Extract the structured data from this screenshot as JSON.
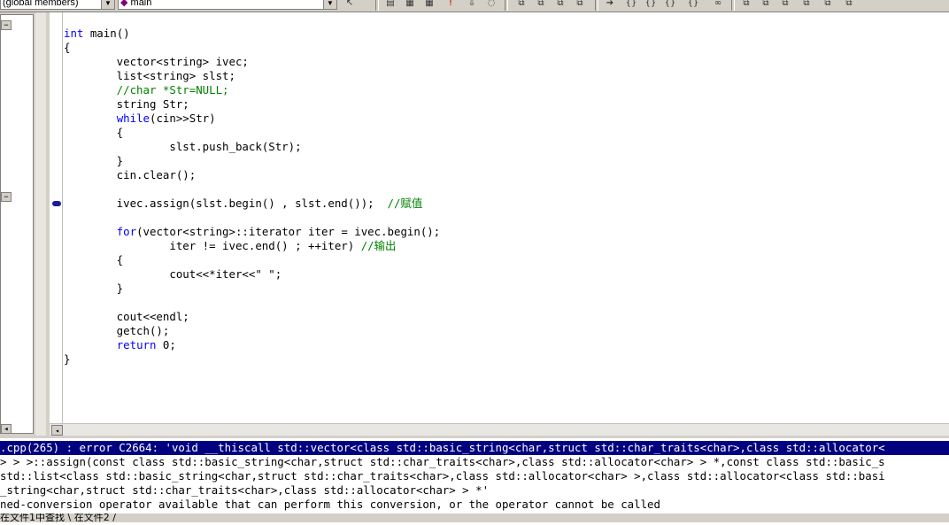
{
  "toolbar": {
    "class_combo": "(global members)",
    "func_combo": "main"
  },
  "editor": {
    "lines": [
      [
        {
          "t": "int",
          "c": "kw"
        },
        {
          "t": " main()"
        }
      ],
      [
        {
          "t": "{"
        }
      ],
      [
        {
          "t": "        vector<string> ivec;"
        }
      ],
      [
        {
          "t": "        list<string> slst;"
        }
      ],
      [
        {
          "t": "        //char *Str=NULL;",
          "c": "cm"
        }
      ],
      [
        {
          "t": "        string Str;"
        }
      ],
      [
        {
          "t": "        "
        },
        {
          "t": "while",
          "c": "kw"
        },
        {
          "t": "(cin>>Str)"
        }
      ],
      [
        {
          "t": "        {"
        }
      ],
      [
        {
          "t": "                slst.push_back(Str);"
        }
      ],
      [
        {
          "t": "        }"
        }
      ],
      [
        {
          "t": "        cin.clear();"
        }
      ],
      [
        {
          "t": ""
        }
      ],
      [
        {
          "t": "        ivec.assign(slst.begin() , slst.end());  "
        },
        {
          "t": "//赋值",
          "c": "cm"
        }
      ],
      [
        {
          "t": ""
        }
      ],
      [
        {
          "t": "        "
        },
        {
          "t": "for",
          "c": "kw"
        },
        {
          "t": "(vector<string>::iterator iter = ivec.begin();"
        }
      ],
      [
        {
          "t": "                iter != ivec.end() ; ++iter) "
        },
        {
          "t": "//输出",
          "c": "cm"
        }
      ],
      [
        {
          "t": "        {"
        }
      ],
      [
        {
          "t": "                cout<<*iter<<\" \";"
        }
      ],
      [
        {
          "t": "        }"
        }
      ],
      [
        {
          "t": ""
        }
      ],
      [
        {
          "t": "        cout<<endl;"
        }
      ],
      [
        {
          "t": "        getch();"
        }
      ],
      [
        {
          "t": "        "
        },
        {
          "t": "return",
          "c": "kw"
        },
        {
          "t": " 0;"
        }
      ],
      [
        {
          "t": "}"
        }
      ]
    ]
  },
  "output": {
    "lines": [
      ".cpp(265) : error C2664: 'void __thiscall std::vector<class std::basic_string<char,struct std::char_traits<char>,class std::allocator<",
      "> > >::assign(const class std::basic_string<char,struct std::char_traits<char>,class std::allocator<char> > *,const class std::basic_s",
      "std::list<class std::basic_string<char,struct std::char_traits<char>,class std::allocator<char> >,class std::allocator<class std::basi",
      "_string<char,struct std::char_traits<char>,class std::allocator<char> > *'",
      "ned-conversion operator available that can perform this conversion, or the operator cannot be called"
    ],
    "tabs": "在文件1中查找 \\ 在文件2 /"
  }
}
